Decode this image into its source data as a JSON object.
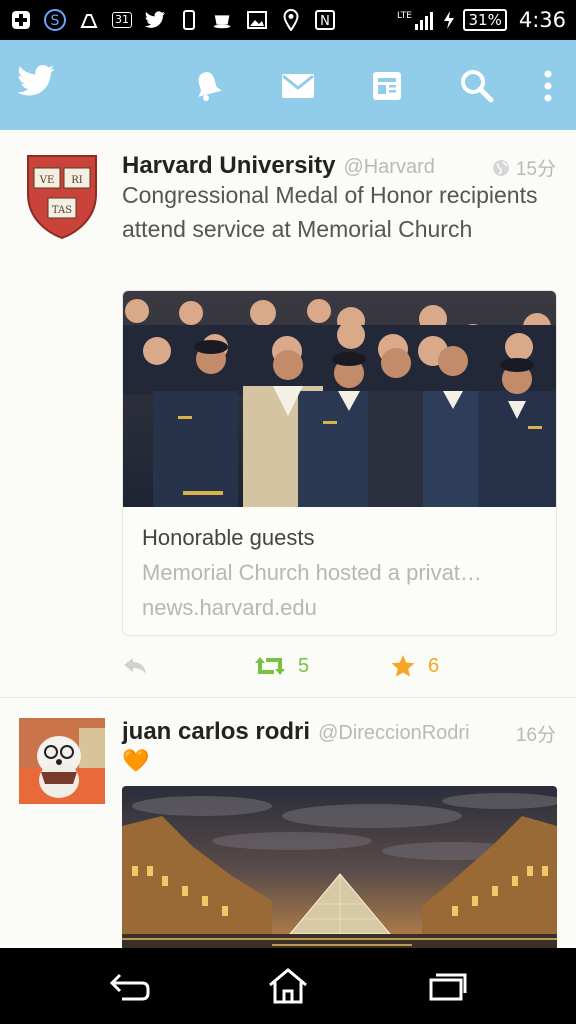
{
  "status_bar": {
    "left_icons": [
      "plus-app-icon",
      "s-app-icon",
      "clean-app-icon",
      "calendar-app-icon",
      "twitter-notification-icon",
      "phone-data-icon",
      "cup-app-icon",
      "image-icon",
      "location-icon",
      "nfc-icon"
    ],
    "calendar_text": "31",
    "network": "LTE",
    "battery": "31%",
    "time": "4:36"
  },
  "toolbar": {
    "icons": [
      "twitter-bird-icon",
      "notifications-bell-icon",
      "messages-envelope-icon",
      "discover-icon",
      "search-icon",
      "overflow-menu-icon"
    ],
    "accent_color": "#91cceb"
  },
  "tweets": [
    {
      "name": "Harvard University",
      "handle": "@Harvard",
      "time": "15分",
      "text": "Congressional Medal of Honor recipients attend service at Memorial Church",
      "avatar_motto": [
        "VE",
        "RI",
        "TAS"
      ],
      "card": {
        "title": "Honorable guests",
        "description": "Memorial Church hosted a privat…",
        "url": "news.harvard.edu"
      },
      "retweets": "5",
      "favorites": "6"
    },
    {
      "name": "juan carlos rodri",
      "handle": "@DireccionRodri",
      "time": "16分",
      "text": "🧡"
    }
  ],
  "colors": {
    "retweet": "#77c243",
    "favorite": "#f5a623",
    "muted": "#b9b9b9"
  }
}
